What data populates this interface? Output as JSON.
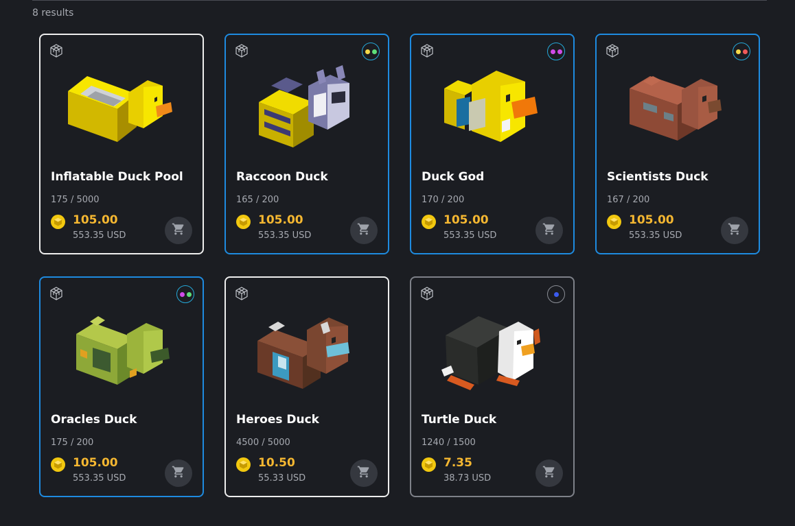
{
  "results_label": "8 results",
  "colors": {
    "accent_blue": "#1e8be0",
    "price": "#f5b731",
    "card_bg": "#1b1d22"
  },
  "cards": [
    {
      "name": "Inflatable Duck Pool",
      "supply": "175 / 5000",
      "price": "105.00",
      "usd": "553.35 USD",
      "border": "white",
      "dots": []
    },
    {
      "name": "Raccoon Duck",
      "supply": "165 / 200",
      "price": "105.00",
      "usd": "553.35 USD",
      "border": "blue",
      "dots": [
        "#f5d94a",
        "#5ee07a"
      ]
    },
    {
      "name": "Duck God",
      "supply": "170 / 200",
      "price": "105.00",
      "usd": "553.35 USD",
      "border": "blue",
      "dots": [
        "#d04be8",
        "#d04be8"
      ]
    },
    {
      "name": "Scientists Duck",
      "supply": "167 / 200",
      "price": "105.00",
      "usd": "553.35 USD",
      "border": "blue",
      "dots": [
        "#f5d94a",
        "#f05a5a"
      ]
    },
    {
      "name": "Oracles Duck",
      "supply": "175 / 200",
      "price": "105.00",
      "usd": "553.35 USD",
      "border": "blue",
      "dots": [
        "#d04be8",
        "#5ee07a"
      ]
    },
    {
      "name": "Heroes Duck",
      "supply": "4500 / 5000",
      "price": "10.50",
      "usd": "55.33 USD",
      "border": "white",
      "dots": []
    },
    {
      "name": "Turtle Duck",
      "supply": "1240 / 1500",
      "price": "7.35",
      "usd": "38.73 USD",
      "border": "gray",
      "dots": [
        "#3b5bef"
      ]
    }
  ],
  "icons": {
    "model": "3d-model-icon",
    "coin": "coin-icon",
    "cart": "cart-icon"
  }
}
